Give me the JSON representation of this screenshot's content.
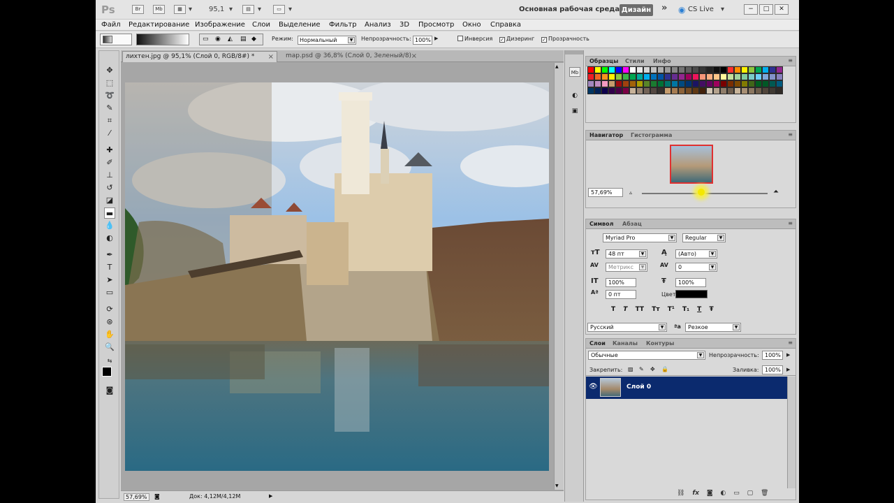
{
  "titlebar": {
    "logo": "Ps",
    "bridge_btn": "Br",
    "minibridge_btn": "Mb",
    "zoom_value": "95,1",
    "workspace_label": "Основная рабочая среда",
    "design_btn": "Дизайн",
    "overflow": "»",
    "cslive": "CS Live",
    "minimize": "−",
    "maximize": "□",
    "close": "✕"
  },
  "menu": [
    "Файл",
    "Редактирование",
    "Изображение",
    "Слои",
    "Выделение",
    "Фильтр",
    "Анализ",
    "3D",
    "Просмотр",
    "Окно",
    "Справка"
  ],
  "options": {
    "mode_label": "Режим:",
    "mode_value": "Нормальный",
    "opacity_label": "Непрозрачность:",
    "opacity_value": "100%",
    "inverse_label": "Инверсия",
    "dither_label": "Дизеринг",
    "transparency_label": "Прозрачность"
  },
  "tabs": [
    {
      "label": "лихтен.jpg @ 95,1% (Слой 0, RGB/8#) *",
      "close": "×"
    },
    {
      "label": "map.psd @ 36,8% (Слой 0, Зеленый/8)",
      "close": "×"
    }
  ],
  "status": {
    "zoom": "57,69%",
    "doc": "Док: 4,12M/4,12M"
  },
  "swatches_panel": {
    "tabs": [
      "Образцы",
      "Стили",
      "Инфо"
    ]
  },
  "navigator_panel": {
    "tabs": [
      "Навигатор",
      "Гистограмма"
    ],
    "zoom": "57,69%"
  },
  "character_panel": {
    "tabs": [
      "Символ",
      "Абзац"
    ],
    "font_family": "Myriad Pro",
    "font_style": "Regular",
    "font_size": "48 пт",
    "leading": "(Авто)",
    "kerning": "Метрикс",
    "tracking": "0",
    "vscale": "100%",
    "hscale": "100%",
    "baseline": "0 пт",
    "color_label": "Цвет:",
    "language": "Русский",
    "antialias": "Резкое",
    "style_buttons": [
      "T",
      "T",
      "TT",
      "Tт",
      "T¹",
      "T₁",
      "T",
      "Ŧ"
    ]
  },
  "layers_panel": {
    "tabs": [
      "Слои",
      "Каналы",
      "Контуры"
    ],
    "blend_mode": "Обычные",
    "opacity_label": "Непрозрачность:",
    "opacity_value": "100%",
    "lock_label": "Закрепить:",
    "fill_label": "Заливка:",
    "fill_value": "100%",
    "layer_name": "Слой 0",
    "footer_icons": [
      "⛓",
      "fx",
      "◙",
      "◐",
      "▭",
      "▢",
      "🗑"
    ]
  },
  "colors": {
    "layer_highlight": "#0b2a6e",
    "design_btn": "#6c6c6c",
    "sky": "#7fb0e0",
    "water": "#2f6478"
  },
  "swatch_colors": [
    "#ff0000",
    "#ffff00",
    "#00ff00",
    "#00ffff",
    "#0000ff",
    "#ff00ff",
    "#ffffff",
    "#ebebeb",
    "#d7d7d7",
    "#c3c3c3",
    "#afafaf",
    "#9b9b9b",
    "#878787",
    "#737373",
    "#5f5f5f",
    "#4b4b4b",
    "#373737",
    "#232323",
    "#0f0f0f",
    "#000000",
    "#ff3030",
    "#ff8a00",
    "#fff200",
    "#8dc63f",
    "#00a651",
    "#00aeef",
    "#2e3192",
    "#92278f",
    "#ed1c24",
    "#f26522",
    "#f7941d",
    "#fff200",
    "#8dc63f",
    "#39b54a",
    "#00a651",
    "#00a99d",
    "#00aeef",
    "#0072bc",
    "#0054a6",
    "#2e3192",
    "#662d91",
    "#92278f",
    "#9e005d",
    "#ed145b",
    "#f69679",
    "#f9ad81",
    "#fdc689",
    "#fff799",
    "#c4df9b",
    "#a3d39c",
    "#82ca9c",
    "#7accc8",
    "#6dcff6",
    "#7da7d9",
    "#8393ca",
    "#8781bd",
    "#a187be",
    "#bd8cbf",
    "#f49ac1",
    "#c69c6d",
    "#9e0b0f",
    "#a0410d",
    "#a36209",
    "#aba000",
    "#598527",
    "#1a7b30",
    "#007236",
    "#00746b",
    "#0076a3",
    "#004a80",
    "#003471",
    "#1b1464",
    "#440e62",
    "#630460",
    "#9e005d",
    "#790000",
    "#7b2e00",
    "#7d4900",
    "#827b00",
    "#406618",
    "#005e20",
    "#005826",
    "#005952",
    "#005b7f",
    "#003663",
    "#002157",
    "#0d004c",
    "#32004b",
    "#4b0049",
    "#7b0046",
    "#c7b299",
    "#998675",
    "#736357",
    "#534741",
    "#37302d",
    "#c69c6d",
    "#a67c52",
    "#8c6239",
    "#754c24",
    "#603913",
    "#42210b",
    "#d3c6b4",
    "#b4a28d",
    "#8f7d6a",
    "#6e5d4c",
    "#c8b49a",
    "#a88f74",
    "#8b7660",
    "#6d5c4a",
    "#50443a",
    "#403a33",
    "#302b26"
  ]
}
